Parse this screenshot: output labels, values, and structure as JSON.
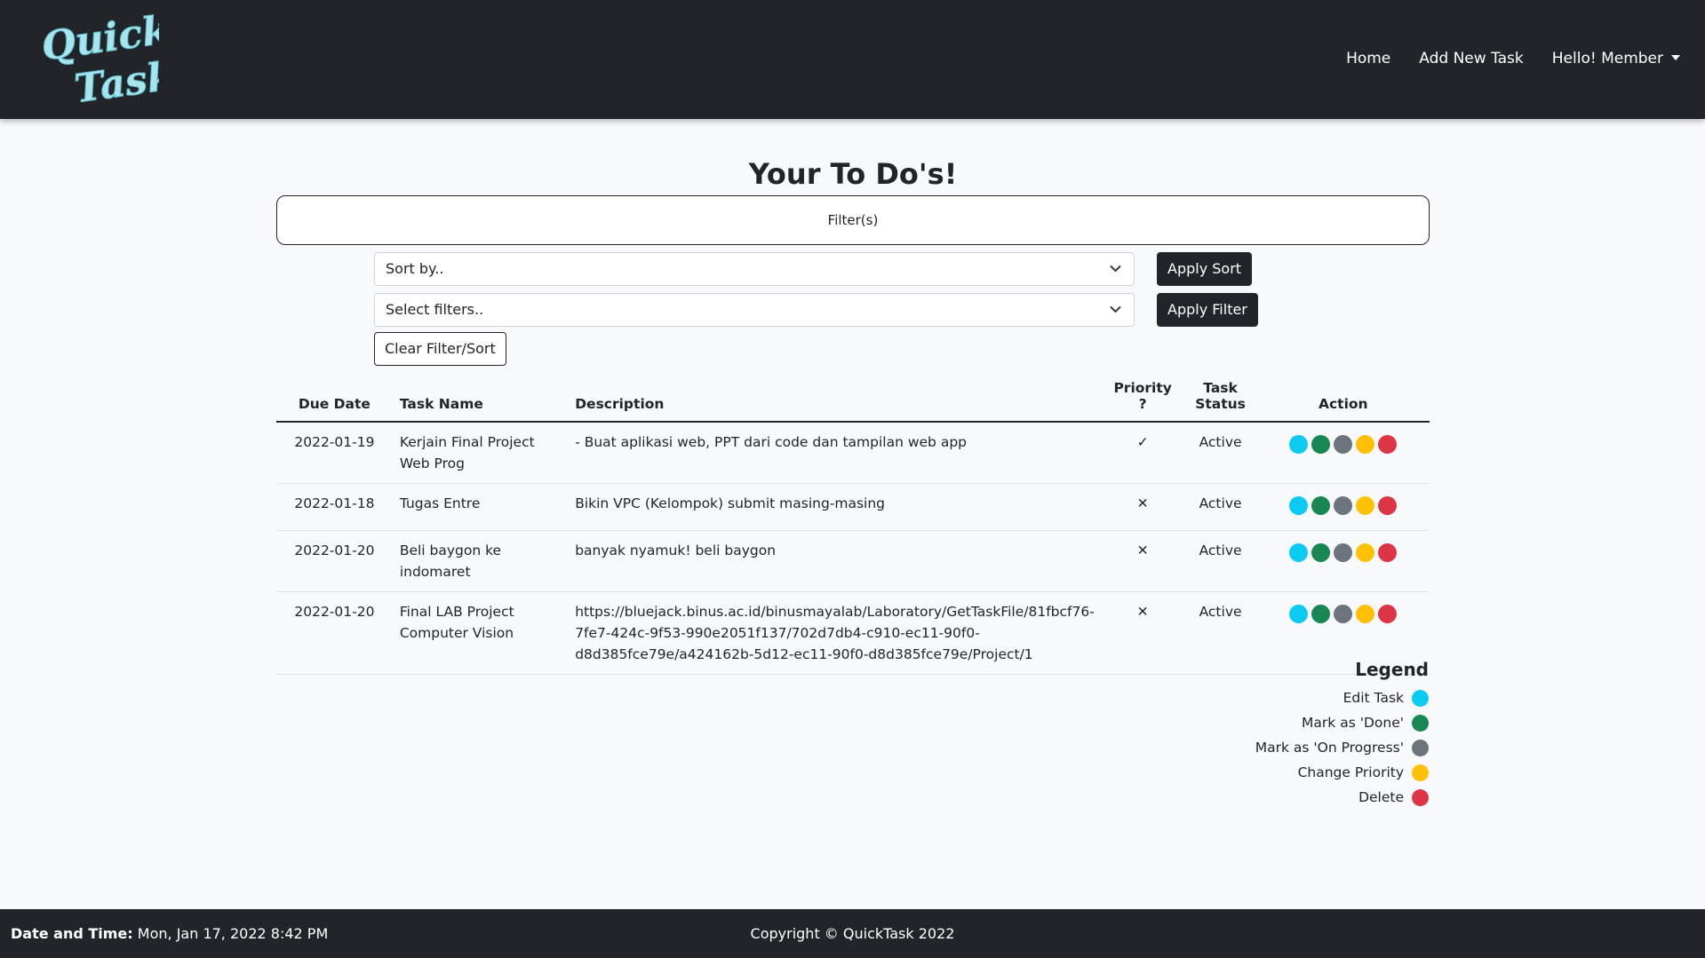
{
  "navbar": {
    "logo_text": "Quick Task",
    "links": [
      {
        "label": "Home"
      },
      {
        "label": "Add New Task"
      },
      {
        "label": "Hello! Member"
      }
    ]
  },
  "main": {
    "title": "Your To Do's!",
    "filter_toggle": "Filter(s)",
    "sort_select": {
      "value": "Sort by.."
    },
    "filter_select": {
      "value": "Select filters.."
    },
    "apply_sort": "Apply Sort",
    "apply_filter": "Apply Filter",
    "clear": "Clear Filter/Sort"
  },
  "table": {
    "headers": [
      "Due Date",
      "Task Name",
      "Description",
      "Priority ?",
      "Task Status",
      "Action"
    ],
    "rows": [
      {
        "date": "2022-01-19",
        "name": "Kerjain Final Project Web Prog",
        "desc": "- Buat aplikasi web, PPT dari code dan tampilan web app",
        "priority": "✓",
        "status": "Active"
      },
      {
        "date": "2022-01-18",
        "name": "Tugas Entre",
        "desc": "Bikin VPC (Kelompok) submit masing-masing",
        "priority": "✕",
        "status": "Active"
      },
      {
        "date": "2022-01-20",
        "name": "Beli baygon ke indomaret",
        "desc": "banyak nyamuk! beli baygon",
        "priority": "✕",
        "status": "Active"
      },
      {
        "date": "2022-01-20",
        "name": "Final LAB Project Computer Vision",
        "desc": "https://bluejack.binus.ac.id/binusmayalab/Laboratory/GetTaskFile/81fbcf76-7fe7-424c-9f53-990e2051f137/702d7db4-c910-ec11-90f0-d8d385fce79e/a424162b-5d12-ec11-90f0-d8d385fce79e/Project/1",
        "priority": "✕",
        "status": "Active"
      }
    ]
  },
  "colors": {
    "edit": "#0dcaf0",
    "done": "#198754",
    "progress": "#6c757d",
    "priority": "#ffc107",
    "delete": "#dc3545"
  },
  "legend": {
    "title": "Legend",
    "items": [
      {
        "label": "Edit Task",
        "color_key": "edit"
      },
      {
        "label": "Mark as 'Done'",
        "color_key": "done"
      },
      {
        "label": "Mark as 'On Progress'",
        "color_key": "progress"
      },
      {
        "label": "Change Priority",
        "color_key": "priority"
      },
      {
        "label": "Delete",
        "color_key": "delete"
      }
    ]
  },
  "footer": {
    "datetime_label": "Date and Time:",
    "datetime_value": "Mon, Jan 17, 2022 8:42 PM",
    "copyright": "Copyright © QuickTask 2022"
  }
}
